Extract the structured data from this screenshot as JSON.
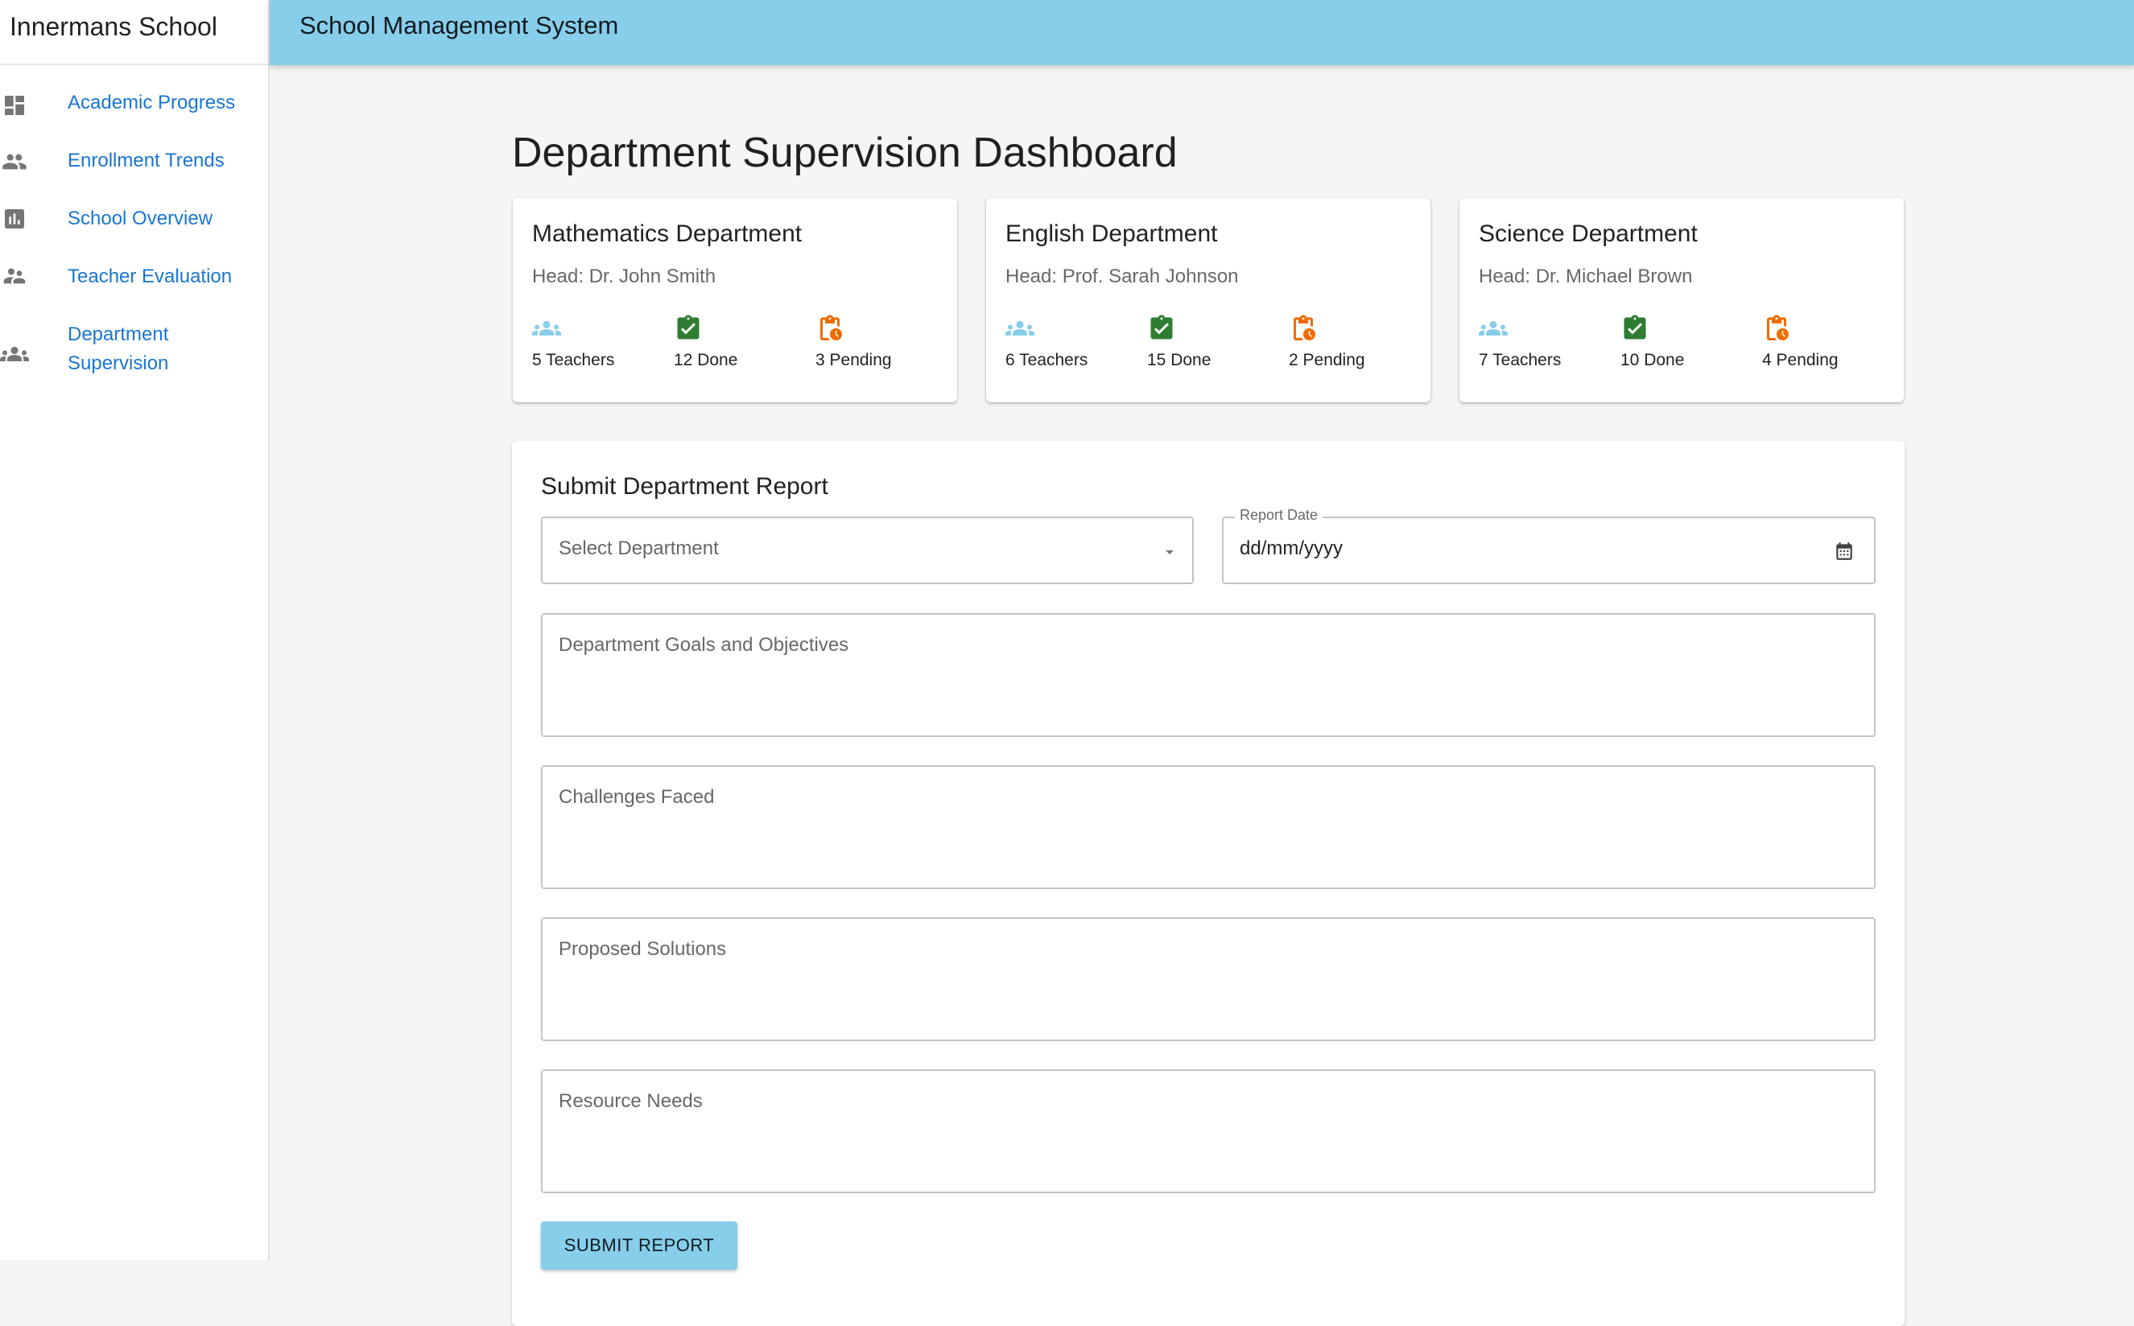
{
  "school_name": "Innermans School",
  "app_title": "School Management System",
  "sidebar": {
    "items": [
      {
        "label": "Academic Progress",
        "icon": "dashboard-icon"
      },
      {
        "label": "Enrollment Trends",
        "icon": "people-icon"
      },
      {
        "label": "School Overview",
        "icon": "bar-chart-icon"
      },
      {
        "label": "Teacher Evaluation",
        "icon": "supervisor-icon"
      },
      {
        "label": "Department Supervision",
        "label_lines": [
          "Department",
          "Supervision"
        ],
        "icon": "groups-icon"
      }
    ]
  },
  "page_title": "Department Supervision Dashboard",
  "departments": [
    {
      "name": "Mathematics Department",
      "head": "Head: Dr. John Smith",
      "teachers": "5 Teachers",
      "done": "12 Done",
      "pending": "3 Pending"
    },
    {
      "name": "English Department",
      "head": "Head: Prof. Sarah Johnson",
      "teachers": "6 Teachers",
      "done": "15 Done",
      "pending": "2 Pending"
    },
    {
      "name": "Science Department",
      "head": "Head: Dr. Michael Brown",
      "teachers": "7 Teachers",
      "done": "10 Done",
      "pending": "4 Pending"
    }
  ],
  "report": {
    "title": "Submit Department Report",
    "department_placeholder": "Select Department",
    "date_label": "Report Date",
    "date_placeholder": "dd/mm/yyyy",
    "goals_placeholder": "Department Goals and Objectives",
    "challenges_placeholder": "Challenges Faced",
    "solutions_placeholder": "Proposed Solutions",
    "resources_placeholder": "Resource Needs",
    "submit_label": "SUBMIT REPORT"
  },
  "colors": {
    "appbar": "#87ceeb",
    "nav_link": "#1976d2",
    "teachers_icon": "#87ceeb",
    "done_icon": "#2e7d32",
    "pending_icon": "#ef6c00"
  }
}
